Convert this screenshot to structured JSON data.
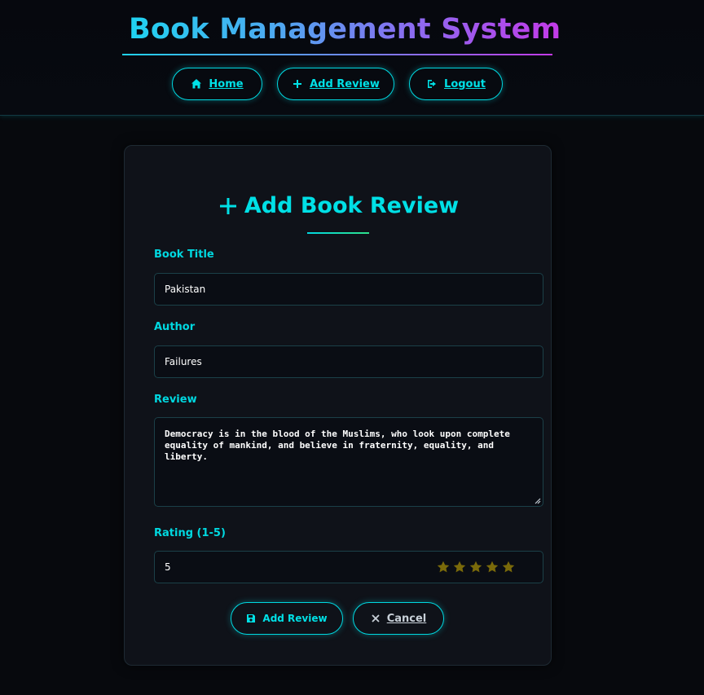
{
  "header": {
    "title": "Book Management System",
    "nav": [
      {
        "label": "Home",
        "icon": "home-icon"
      },
      {
        "label": "Add Review",
        "icon": "plus-icon"
      },
      {
        "label": "Logout",
        "icon": "logout-icon"
      }
    ]
  },
  "form": {
    "heading": "Add Book Review",
    "book_title_label": "Book Title",
    "book_title_value": "Pakistan",
    "author_label": "Author",
    "author_value": "Failures",
    "review_label": "Review",
    "review_value": "Democracy is in the blood of the Muslims, who look upon complete equality of mankind, and believe in fraternity, equality, and liberty.",
    "rating_label": "Rating (1-5)",
    "rating_value": "5",
    "rating_stars": 5,
    "submit_label": "Add Review",
    "cancel_label": "Cancel"
  },
  "colors": {
    "accent": "#00e0e6",
    "star": "#7a6a0a",
    "background": "#07090d",
    "card": "#0f1219"
  }
}
